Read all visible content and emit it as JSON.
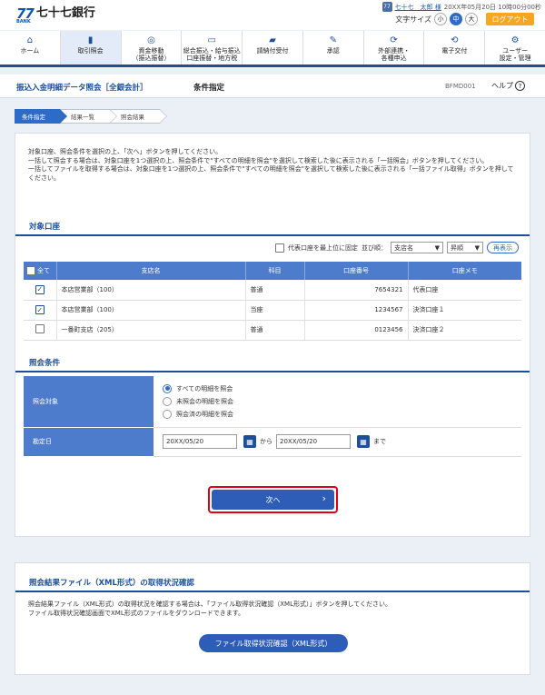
{
  "header": {
    "logo_num": "77",
    "logo_bank": "BANK",
    "bank_name": "七十七銀行",
    "user_icon": "person-icon",
    "user_name": "七十七　太郎 様",
    "login_time": "20XX年05月20日 10時00分00秒",
    "font_size_label": "文字サイズ",
    "font_sizes": [
      "小",
      "中",
      "大"
    ],
    "font_size_active": "中",
    "logout": "ログアウト"
  },
  "nav": [
    {
      "icon": "home-icon",
      "label": "ホーム"
    },
    {
      "icon": "document-icon",
      "label": "取引照会"
    },
    {
      "icon": "fund-transfer-icon",
      "label": "資金移動\n（振込振替）"
    },
    {
      "icon": "payroll-icon",
      "label": "総合振込・給与振込\n口座振替・地方税"
    },
    {
      "icon": "tax-payment-icon",
      "label": "請納付受付"
    },
    {
      "icon": "approve-icon",
      "label": "承認"
    },
    {
      "icon": "external-link-icon",
      "label": "外部連携・\n各種申込"
    },
    {
      "icon": "e-delivery-icon",
      "label": "電子交付"
    },
    {
      "icon": "user-settings-icon",
      "label": "ユーザー\n設定・管理"
    }
  ],
  "nav_active": 1,
  "page": {
    "title": "振込入金明細データ照会［全銀会計］",
    "subtitle": "条件指定",
    "screen_id": "BFMD001",
    "help": "ヘルプ"
  },
  "steps": [
    "条件指定",
    "結果一覧",
    "照会結果"
  ],
  "intro": [
    "対象口座、照会条件を選択の上、「次へ」ボタンを押してください。",
    "一括して照会する場合は、対象口座を1つ選択の上、照会条件で\"すべての明細を照会\"を選択して検索した後に表示される「一括照会」ボタンを押してください。",
    "一括してファイルを取得する場合は、対象口座を1つ選択の上、照会条件で\"すべての明細を照会\"を選択して検索した後に表示される「一括ファイル取得」ボタンを押してください。"
  ],
  "account_section": {
    "heading": "対象口座",
    "pin_label": "代表口座を最上位に固定",
    "sort_label": "並び順：",
    "sort_key": "支店名",
    "sort_order": "昇順",
    "redisplay": "再表示",
    "columns": [
      "全て",
      "支店名",
      "科目",
      "口座番号",
      "口座メモ"
    ],
    "rows": [
      {
        "checked": true,
        "branch": "本店営業部（100）",
        "type": "普通",
        "number": "7654321",
        "memo": "代表口座"
      },
      {
        "checked": true,
        "branch": "本店営業部（100）",
        "type": "当座",
        "number": "1234567",
        "memo": "決済口座１"
      },
      {
        "checked": false,
        "branch": "一番町支店（205）",
        "type": "普通",
        "number": "0123456",
        "memo": "決済口座２"
      }
    ]
  },
  "condition_section": {
    "heading": "照会条件",
    "target_label": "照会対象",
    "options": [
      "すべての明細を照会",
      "未照会の明細を照会",
      "照会済の明細を照会"
    ],
    "selected": 0,
    "date_label": "勘定日",
    "date_from": "20XX/05/20",
    "date_to": "20XX/05/20",
    "from_word": "から",
    "to_word": "まで"
  },
  "next_button": "次へ",
  "xml_section": {
    "heading": "照会結果ファイル（XML形式）の取得状況確認",
    "desc": [
      "照会結果ファイル（XML形式）の取得状況を確認する場合は、「ファイル取得状況確認（XML形式）」ボタンを押してください。",
      "ファイル取得状況確認画面でXML形式のファイルをダウンロードできます。"
    ],
    "button": "ファイル取得状況確認（XML形式）"
  }
}
